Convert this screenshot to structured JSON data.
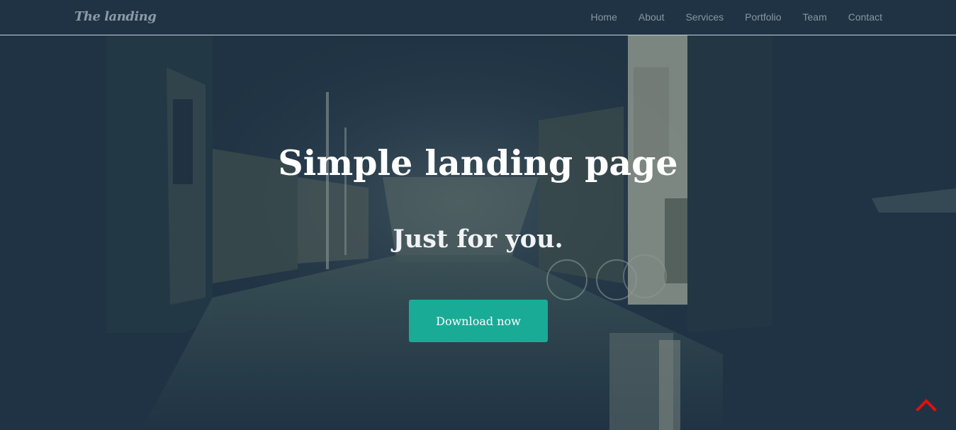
{
  "navbar": {
    "brand": "The landing",
    "links": [
      "Home",
      "About",
      "Services",
      "Portfolio",
      "Team",
      "Contact"
    ]
  },
  "hero": {
    "title": "Simple landing page",
    "subtitle": "Just for you.",
    "cta_label": "Download now"
  },
  "back_to_top": {
    "icon": "chevron-up-icon"
  },
  "colors": {
    "background": "#1f3344",
    "accent_button": "#1aab97",
    "nav_text": "#8a96a2",
    "back_to_top": "#e01010"
  }
}
